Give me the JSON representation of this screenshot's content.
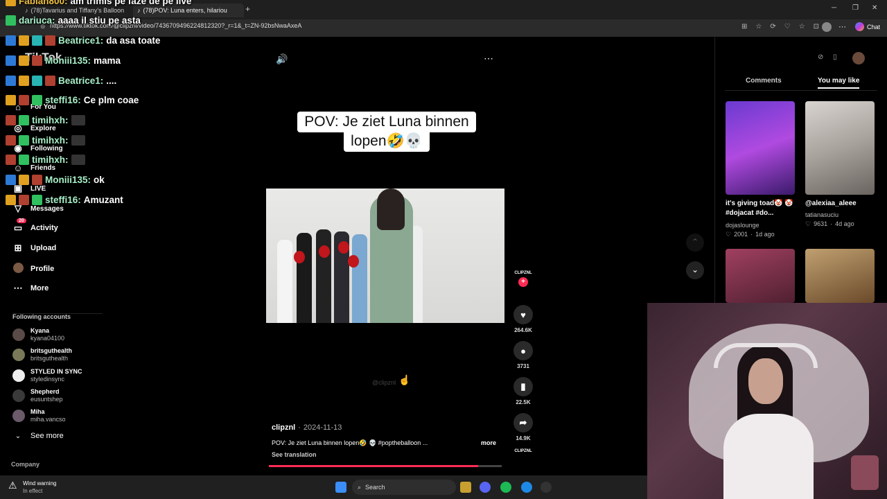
{
  "browser": {
    "tabs": [
      {
        "label": "(78)Tavarius and Tiffany's Balloon"
      },
      {
        "label": "(78)POV: Luna enters, hilariou"
      }
    ],
    "url": "https://www.tiktok.com/@clipznl/video/7436709496224812320?_r=1&_t=ZN-92bsNwaAxeA",
    "chat_label": "Chat"
  },
  "chat_overlay": [
    {
      "user": "Fabian800:",
      "text": "am trimis pe faze de pe live"
    },
    {
      "user": "dariuca:",
      "text": "aaaa il stiu pe asta"
    },
    {
      "user": "Beatrice1:",
      "text": "da asa toate"
    },
    {
      "user": "Moniii135:",
      "text": "mama"
    },
    {
      "user": "Beatrice1:",
      "text": "...."
    },
    {
      "user": "steffi16:",
      "text": "Ce plm coae"
    },
    {
      "user": "timihxh:",
      "text": ""
    },
    {
      "user": "timihxh:",
      "text": ""
    },
    {
      "user": "timihxh:",
      "text": ""
    },
    {
      "user": "Moniii135:",
      "text": "ok"
    },
    {
      "user": "steffi16:",
      "text": "Amuzant"
    }
  ],
  "leftnav": {
    "logo": "TikTok",
    "items": [
      {
        "label": "For You"
      },
      {
        "label": "Explore"
      },
      {
        "label": "Following"
      },
      {
        "label": "Friends"
      },
      {
        "label": "LIVE"
      },
      {
        "label": "Messages"
      },
      {
        "label": "Activity",
        "badge": "20"
      },
      {
        "label": "Upload"
      },
      {
        "label": "Profile"
      },
      {
        "label": "More"
      }
    ],
    "following_title": "Following accounts",
    "accounts": [
      {
        "name": "Kyana",
        "handle": "kyana04100"
      },
      {
        "name": "britsguthealth",
        "handle": "britsguthealth"
      },
      {
        "name": "STYLED IN SYNC",
        "handle": "styledinsync"
      },
      {
        "name": "Shepherd",
        "handle": "eusuntshep"
      },
      {
        "name": "Miha",
        "handle": "miha.vancso"
      }
    ],
    "see_more": "See more",
    "company": "Company"
  },
  "video": {
    "caption_line1": "POV: Je ziet Luna binnen",
    "caption_line2": "lopen🤣💀",
    "watermark": "@clipznl",
    "author": "clipznl",
    "date": "2024-11-13",
    "description": "POV: Je ziet Luna binnen lopen🤣 💀 #poptheballoon ...",
    "more": "more",
    "see_translation": "See translation",
    "progress": 0.9,
    "likes": "264.6K",
    "comments": "3731",
    "saves": "22.5K",
    "shares": "14.9K",
    "creator_avatar": "CLIPZNL"
  },
  "rightpanel": {
    "tab_comments": "Comments",
    "tab_you_may_like": "You may like",
    "cards": [
      {
        "title": "it's giving toad🤡 🤡 #dojacat #do...",
        "user": "dojaslounge",
        "likes": "2001",
        "time": "1d ago"
      },
      {
        "title": "@alexiaa_aleee",
        "user": "tatianasuciu",
        "likes": "9631",
        "time": "4d ago"
      }
    ]
  },
  "taskbar": {
    "weather_title": "Wind warning",
    "weather_sub": "In effect",
    "search": "Search"
  },
  "colors": {
    "accent": "#fe2c55",
    "chat_user": "#a8f0c8"
  }
}
